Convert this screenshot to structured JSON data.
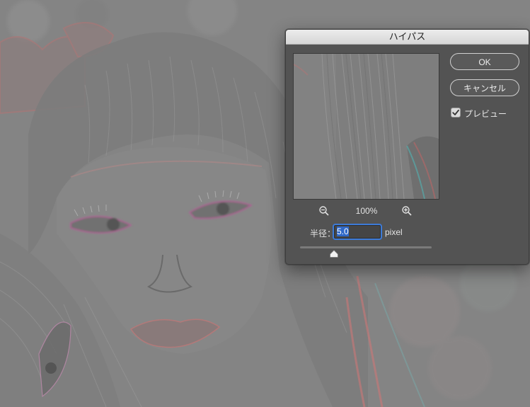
{
  "dialog": {
    "title": "ハイパス",
    "ok_label": "OK",
    "cancel_label": "キャンセル",
    "preview_label": "プレビュー",
    "preview_checked": true,
    "zoom_level": "100%",
    "radius_label": "半径：",
    "radius_value": "5.0",
    "radius_unit": "pixel",
    "radius_slider_fraction": 0.26
  },
  "icons": {
    "zoom_out": "zoom-out-magnifier-icon",
    "zoom_in": "zoom-in-magnifier-icon",
    "check": "checkmark-icon",
    "slider_thumb": "triangle-thumb-icon"
  },
  "colors": {
    "dialog_bg": "#535353",
    "accent": "#3d7bd8",
    "canvas_gray": "#858585"
  }
}
